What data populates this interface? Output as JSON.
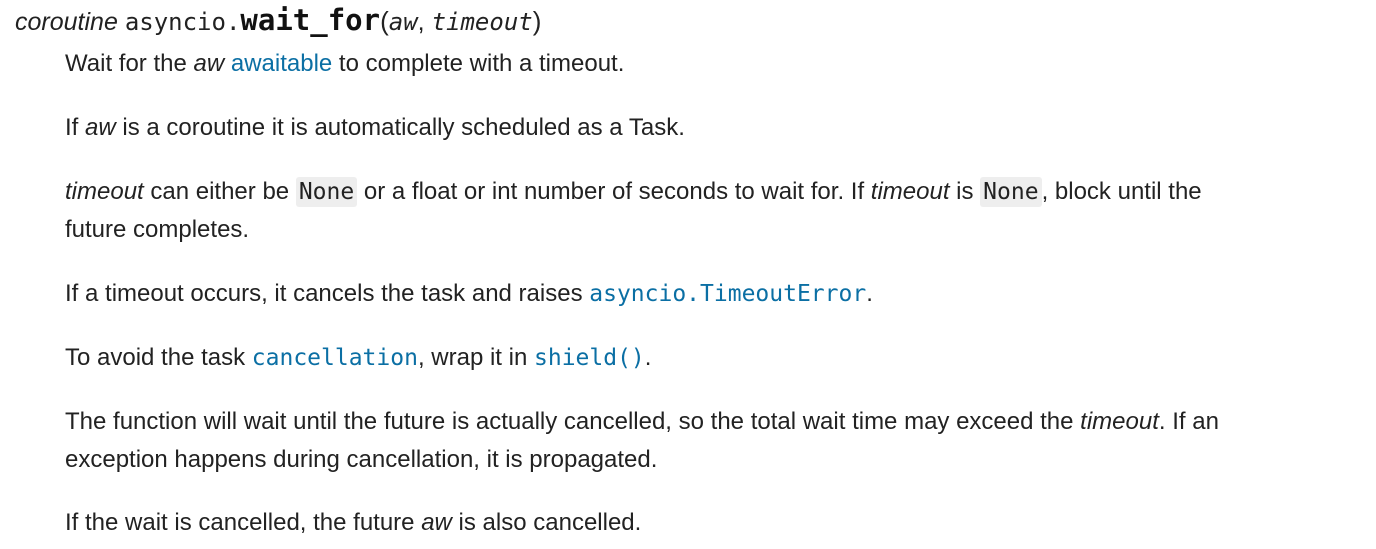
{
  "signature": {
    "prefix": "coroutine",
    "module": "asyncio.",
    "name": "wait_for",
    "open_paren": "(",
    "param1": "aw",
    "sep": ", ",
    "param2": "timeout",
    "close_paren": ")"
  },
  "p1": {
    "t1": "Wait for the ",
    "em1": "aw",
    "t2": " ",
    "link": "awaitable",
    "t3": " to complete with a timeout."
  },
  "p2": {
    "t1": "If ",
    "em1": "aw",
    "t2": " is a coroutine it is automatically scheduled as a Task."
  },
  "p3": {
    "em1": "timeout",
    "t1": " can either be ",
    "code1": "None",
    "t2": " or a float or int number of seconds to wait for. If ",
    "em2": "timeout",
    "t3": " is ",
    "code2": "None",
    "t4": ", block until the",
    "line2": "future completes."
  },
  "p4": {
    "t1": "If a timeout occurs, it cancels the task and raises ",
    "link": "asyncio.TimeoutError",
    "t2": "."
  },
  "p5": {
    "t1": "To avoid the task ",
    "link1": "cancellation",
    "t2": ", wrap it in ",
    "link2": "shield()",
    "t3": "."
  },
  "p6": {
    "t1": "The function will wait until the future is actually cancelled, so the total wait time may exceed the ",
    "em1": "timeout",
    "t2": ". If an",
    "line2": "exception happens during cancellation, it is propagated."
  },
  "p7": {
    "t1": "If the wait is cancelled, the future ",
    "em1": "aw",
    "t2": " is also cancelled."
  },
  "colors": {
    "text": "#222222",
    "link": "#0b6fa4",
    "code_bg": "#eeeeee"
  }
}
